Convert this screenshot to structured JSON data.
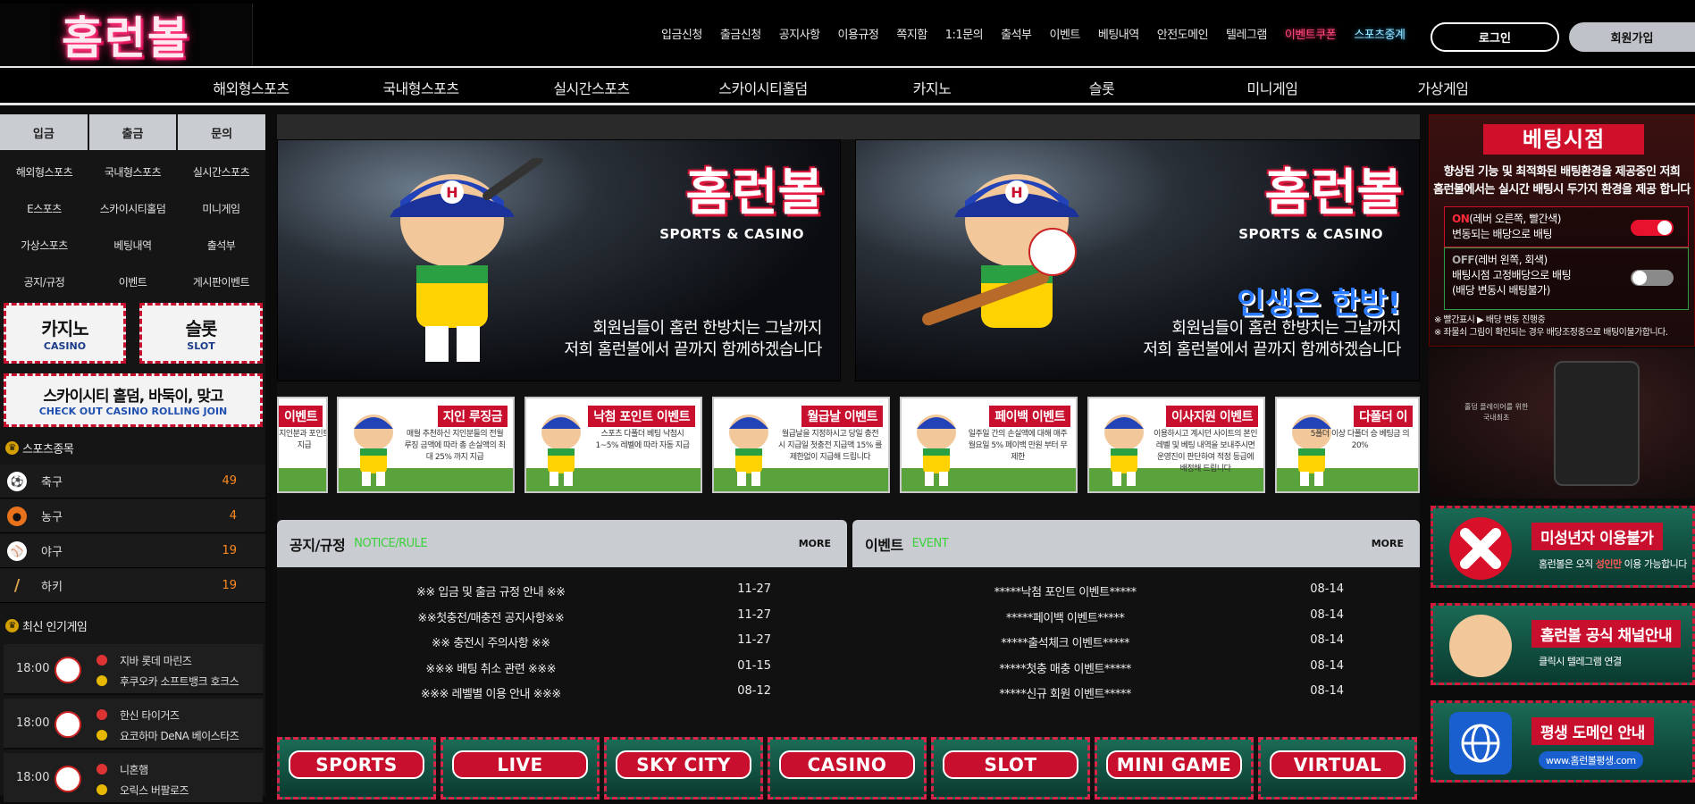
{
  "header": {
    "logo": "홈런볼",
    "topnav": [
      "입금신청",
      "출금신청",
      "공지사항",
      "이용규정",
      "쪽지함",
      "1:1문의",
      "출석부",
      "이벤트",
      "베팅내역",
      "안전도메인",
      "텔레그램",
      "이벤트쿠폰",
      "스포츠중계"
    ],
    "login_label": "로그인",
    "join_label": "회원가입"
  },
  "mainnav": [
    "해외형스포츠",
    "국내형스포츠",
    "실시간스포츠",
    "스카이시티홀덤",
    "카지노",
    "슬롯",
    "미니게임",
    "가상게임"
  ],
  "sidebar": {
    "tabs": [
      "입금",
      "출금",
      "문의"
    ],
    "grid": [
      "해외형스포츠",
      "국내형스포츠",
      "실시간스포츠",
      "E스포츠",
      "스카이시티홀덤",
      "미니게임",
      "가상스포츠",
      "베팅내역",
      "출석부",
      "공지/규정",
      "이벤트",
      "게시판이벤트"
    ],
    "banner_casino": {
      "title": "카지노",
      "sub": "CASINO"
    },
    "banner_slot": {
      "title": "슬롯",
      "sub": "SLOT"
    },
    "banner_holdem": {
      "title": "스카이시티 홀덤, 바둑이, 맞고",
      "sub": "CHECK OUT CASINO ROLLING JOIN"
    },
    "sports_title": "스포츠종목",
    "sports": [
      {
        "name": "축구",
        "count": "49",
        "icon": "soccer-icon",
        "color": "#ffffff"
      },
      {
        "name": "농구",
        "count": "4",
        "icon": "basketball-icon",
        "color": "#e8731c"
      },
      {
        "name": "야구",
        "count": "19",
        "icon": "baseball-icon",
        "color": "#ffffff"
      },
      {
        "name": "하키",
        "count": "19",
        "icon": "hockey-icon",
        "color": "#d8a24a"
      }
    ],
    "popular_title": "최신 인기게임",
    "games": [
      {
        "time": "18:00",
        "home": "지바 롯데 마린즈",
        "away": "후쿠오카 소프트뱅크 호크스"
      },
      {
        "time": "18:00",
        "home": "한신 타이거즈",
        "away": "요코하마 DeNA 베이스타즈"
      },
      {
        "time": "18:00",
        "home": "니혼햄",
        "away": "오릭스 버팔로즈"
      }
    ]
  },
  "hero": [
    {
      "logo": "홈런볼",
      "sc_a": "SPORTS & CASINO",
      "slogan": "",
      "cap1": "회원님들이 홈런 한방치는 그날까지",
      "cap2": "저희 홈런볼에서 끝까지 함께하겠습니다"
    },
    {
      "logo": "홈런볼",
      "sc_a": "SPORTS & CASINO",
      "slogan": "인생은 한방!",
      "cap1": "회원님들이 홈런 한방치는 그날까지",
      "cap2": "저희 홈런볼에서 끝까지 함께하겠습니다"
    }
  ],
  "promos": [
    {
      "title": "이벤트",
      "desc": "지인분과 포인트 지급"
    },
    {
      "title": "지인 루징금",
      "desc": "매월 추천하신 지인분들의 전월 루징 금액에 따라 총 손실액의 최대 25% 까지 지급"
    },
    {
      "title": "낙첨 포인트 이벤트",
      "desc": "스포츠 다폴더 베팅 낙첨시 1~5% 레벨에 따라 자동 지급"
    },
    {
      "title": "월급날 이벤트",
      "desc": "월급날을 지정하시고 당일 충전 시 지급일 첫충전 지급액 15% 를 제한없이 지급해 드립니다"
    },
    {
      "title": "페이백 이벤트",
      "desc": "일주일 간의 손실액에 대해 매주 월요일 5% 페이백 만원 부터 무제한"
    },
    {
      "title": "이사지원 이벤트",
      "desc": "이용하시고 계시던 사이트의 본인 레벨 및 베팅 내역을 보내주시면 운영진이 판단하여 적정 등급에 배정해 드립니다"
    },
    {
      "title": "다폴더 이",
      "desc": "5폴더 이상 다폴더 승 베팅금 의 20%"
    }
  ],
  "notice": {
    "title": "공지/규정",
    "sub": "NOTICE/RULE",
    "more": "MORE",
    "rows": [
      {
        "t": "※※ 입금 및 출금 규정 안내 ※※",
        "d": "11-27"
      },
      {
        "t": "※※첫충전/매충전 공지사항※※",
        "d": "11-27"
      },
      {
        "t": "※※ 충전시 주의사항 ※※",
        "d": "11-27"
      },
      {
        "t": "※※※ 배팅 취소 관련 ※※※",
        "d": "01-15"
      },
      {
        "t": "※※※ 레벨별 이용 안내 ※※※",
        "d": "08-12"
      }
    ]
  },
  "event": {
    "title": "이벤트",
    "sub": "EVENT",
    "more": "MORE",
    "rows": [
      {
        "t": "*****낙첨 포인트 이벤트*****",
        "d": "08-14"
      },
      {
        "t": "*****페이백 이벤트*****",
        "d": "08-14"
      },
      {
        "t": "*****출석체크 이벤트*****",
        "d": "08-14"
      },
      {
        "t": "*****첫충 매충 이벤트*****",
        "d": "08-14"
      },
      {
        "t": "*****신규 회원 이벤트*****",
        "d": "08-14"
      }
    ]
  },
  "categories": [
    "SPORTS",
    "LIVE",
    "SKY CITY",
    "CASINO",
    "SLOT",
    "MINI GAME",
    "VIRTUAL"
  ],
  "right": {
    "bet_title": "베팅시점",
    "bet_desc1": "향상된 기능 및 최적화된 배팅환경을 제공중인 저희",
    "bet_desc2": "홈런볼에서는 실시간 배팅시 두가지 환경을 제공 합니다",
    "on_tag": "ON",
    "on_l1": "(레버 오른쪽, 빨간색)",
    "on_l2": "변동되는 배당으로 배팅",
    "off_tag": "OFF",
    "off_l1": "(레버 왼쪽, 회색)",
    "off_l2": "배팅시점 고정배당으로 배팅",
    "off_l3": "(배당 변동시 배팅불가)",
    "note1": "※ 빨간표시 ▶ 배당 변동 진행중",
    "note2": "※ 좌물쇠 그림이 확인되는 경우 배당조정중으로 배팅이불가합니다.",
    "phone_text1": "홀덤 플레이어를 위한",
    "phone_text2": "국내최초",
    "banners": [
      {
        "title": "미성년자 이용불가",
        "sub_a": "홈런볼은 오직 ",
        "sub_b": "성인만",
        "sub_c": " 이용 가능합니다"
      },
      {
        "title": "홈런볼 공식 채널안내",
        "sub_a": "클릭시 텔레그램 연결",
        "sub_b": "",
        "sub_c": ""
      },
      {
        "title": "평생 도메인 안내",
        "sub_a": "www.홈런볼평생.com",
        "sub_b": "",
        "sub_c": ""
      }
    ]
  }
}
